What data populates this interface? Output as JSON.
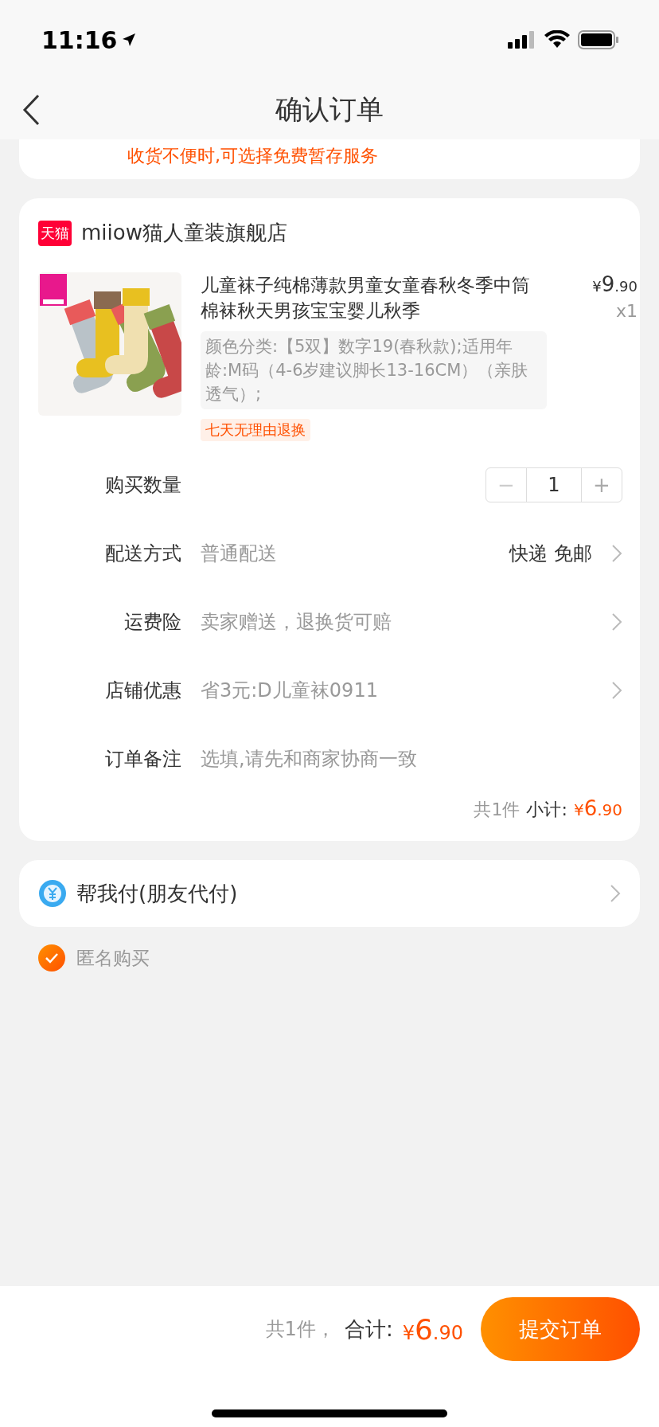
{
  "status_bar": {
    "time": "11:16"
  },
  "header": {
    "title": "确认订单"
  },
  "notice": {
    "text": "收货不便时,可选择免费暂存服务"
  },
  "store": {
    "badge": "天猫",
    "name": "miiow猫人童装旗舰店",
    "product": {
      "title": "儿童袜子纯棉薄款男童女童春秋冬季中筒棉袜秋天男孩宝宝婴儿秋季",
      "specs": "颜色分类:【5双】数字19(春秋款);适用年龄:M码（4-6岁建议脚长13-16CM）（亲肤透气）;",
      "tag": "七天无理由退换",
      "price": {
        "symbol": "¥",
        "integer": "9",
        "decimal": ".90"
      },
      "quantity": "x1"
    },
    "rows": [
      {
        "kind": "stepper",
        "label": "购买数量",
        "decrement": "−",
        "value": "1",
        "increment": "+",
        "decrement_disabled": true
      },
      {
        "kind": "select",
        "label": "配送方式",
        "value": "普通配送",
        "right": "快递 免邮"
      },
      {
        "kind": "select",
        "label": "运费险",
        "value": "卖家赠送，退换货可赔"
      },
      {
        "kind": "select",
        "label": "店铺优惠",
        "value": "省3元:D儿童袜0911"
      },
      {
        "kind": "input",
        "label": "订单备注",
        "placeholder": "选填,请先和商家协商一致"
      }
    ],
    "summary": {
      "count": "共1件",
      "label": "小计:",
      "symbol": "¥",
      "integer": "6",
      "decimal": ".90"
    }
  },
  "friend_pay": {
    "label": "帮我付(朋友代付)"
  },
  "anonymous": {
    "label": "匿名购买",
    "checked": true
  },
  "footer": {
    "count": "共1件，",
    "label": "合计:",
    "symbol": "¥",
    "integer": "6",
    "decimal": ".90",
    "submit": "提交订单"
  }
}
